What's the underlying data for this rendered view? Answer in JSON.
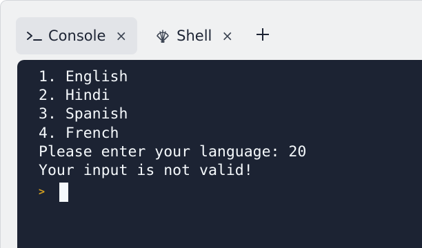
{
  "tabs": [
    {
      "label": "Console",
      "icon": "terminal-prompt-icon",
      "close": "×",
      "active": true
    },
    {
      "label": "Shell",
      "icon": "shell-icon",
      "close": "×",
      "active": false
    }
  ],
  "new_tab_icon": "plus-icon",
  "terminal": {
    "lines": [
      "1. English",
      "2. Hindi",
      "3. Spanish",
      "4. French",
      "Please enter your language: 20",
      "Your input is not valid!"
    ],
    "prompt_symbol": ">"
  },
  "colors": {
    "terminal_bg": "#1c2333",
    "terminal_text": "#f5f9fc",
    "prompt_accent": "#d4a021",
    "active_tab_bg": "#e2e4e8",
    "chrome_bg": "#f0f1f2"
  }
}
